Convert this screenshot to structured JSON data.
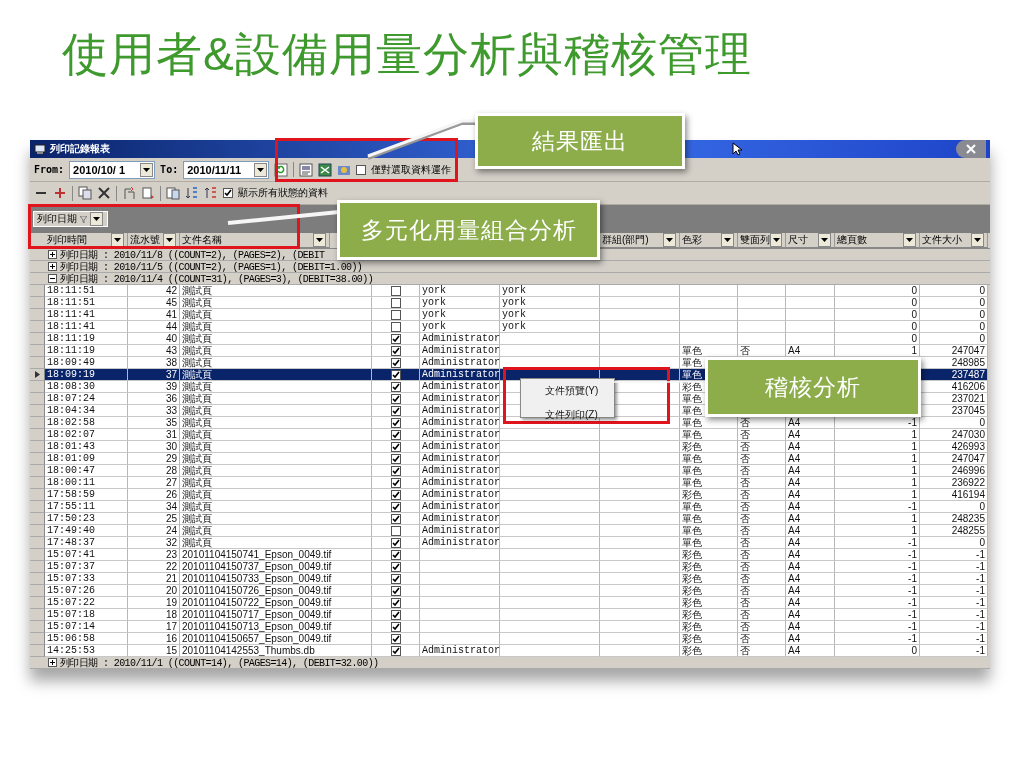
{
  "slide_title": "使用者&設備用量分析與稽核管理",
  "window": {
    "title": "列印記錄報表"
  },
  "toolbar": {
    "from_label": "From:",
    "from_date": "2010/10/ 1",
    "to_label": "To:",
    "to_date": "2010/11/11",
    "selection_only": {
      "label": "僅對選取資料運作",
      "checked": false
    }
  },
  "toolbar_2": {
    "show_all": {
      "label": "顯示所有狀態的資料",
      "checked": true
    }
  },
  "group_panel": {
    "chips": [
      "列印日期"
    ]
  },
  "columns": [
    "列印時間",
    "流水號",
    "文件名稱",
    "群組(部門)",
    "色彩",
    "雙面列",
    "尺寸",
    "總頁數",
    "文件大小"
  ],
  "groups": [
    {
      "label": "列印日期 : 2010/11/8 ((COUNT=2), (PAGES=2), (DEBIT",
      "expanded": false
    },
    {
      "label": "列印日期 : 2010/11/5 ((COUNT=2), (PAGES=1), (DEBIT=1.00))",
      "expanded": false
    },
    {
      "label": "列印日期 : 2010/11/4 ((COUNT=31), (PAGES=3), (DEBIT=38.00))",
      "expanded": true,
      "rows": [
        {
          "time": "18:11:51",
          "serial": "42",
          "file_name": "測試頁",
          "checked": false,
          "column_5": "york",
          "column_6": "york",
          "pages": "0",
          "file_size": "0",
          "selected": false
        },
        {
          "time": "18:11:51",
          "serial": "45",
          "file_name": "測試頁",
          "checked": false,
          "column_5": "york",
          "column_6": "york",
          "pages": "0",
          "file_size": "0",
          "selected": false
        },
        {
          "time": "18:11:41",
          "serial": "41",
          "file_name": "測試頁",
          "checked": false,
          "column_5": "york",
          "column_6": "york",
          "pages": "0",
          "file_size": "0",
          "selected": false
        },
        {
          "time": "18:11:41",
          "serial": "44",
          "file_name": "測試頁",
          "checked": false,
          "column_5": "york",
          "column_6": "york",
          "pages": "0",
          "file_size": "0",
          "selected": false
        },
        {
          "time": "18:11:19",
          "serial": "40",
          "file_name": "測試頁",
          "checked": true,
          "column_5": "Administrator",
          "pages": "0",
          "file_size": "0",
          "selected": false
        },
        {
          "time": "18:11:19",
          "serial": "43",
          "file_name": "測試頁",
          "checked": true,
          "column_5": "Administrator",
          "color_mode": "單色",
          "duplex": "否",
          "size": "A4",
          "pages": "1",
          "file_size": "247047",
          "selected": false
        },
        {
          "time": "18:09:49",
          "serial": "38",
          "file_name": "測試頁",
          "checked": true,
          "column_5": "Administrator",
          "color_mode": "單色",
          "file_size": "248985",
          "selected": false
        },
        {
          "time": "18:09:19",
          "serial": "37",
          "file_name": "測試頁",
          "checked": true,
          "column_5": "Administrator",
          "color_mode": "單色",
          "file_size": "237487",
          "selected": true
        },
        {
          "time": "18:08:30",
          "serial": "39",
          "file_name": "測試頁",
          "checked": true,
          "column_5": "Administrator",
          "color_mode": "彩色",
          "file_size": "416206",
          "selected": false
        },
        {
          "time": "18:07:24",
          "serial": "36",
          "file_name": "測試頁",
          "checked": true,
          "column_5": "Administrator",
          "color_mode": "單色",
          "file_size": "237021",
          "selected": false
        },
        {
          "time": "18:04:34",
          "serial": "33",
          "file_name": "測試頁",
          "checked": true,
          "column_5": "Administrator",
          "color_mode": "單色",
          "file_size": "237045",
          "selected": false
        },
        {
          "time": "18:02:58",
          "serial": "35",
          "file_name": "測試頁",
          "checked": true,
          "column_5": "Administrator",
          "color_mode": "單色",
          "duplex": "否",
          "size": "A4",
          "pages": "-1",
          "file_size": "0",
          "selected": false
        },
        {
          "time": "18:02:07",
          "serial": "31",
          "file_name": "測試頁",
          "checked": true,
          "column_5": "Administrator",
          "color_mode": "單色",
          "duplex": "否",
          "size": "A4",
          "pages": "1",
          "file_size": "247030",
          "selected": false
        },
        {
          "time": "18:01:43",
          "serial": "30",
          "file_name": "測試頁",
          "checked": true,
          "column_5": "Administrator",
          "color_mode": "彩色",
          "duplex": "否",
          "size": "A4",
          "pages": "1",
          "file_size": "426993",
          "selected": false
        },
        {
          "time": "18:01:09",
          "serial": "29",
          "file_name": "測試頁",
          "checked": true,
          "column_5": "Administrator",
          "color_mode": "單色",
          "duplex": "否",
          "size": "A4",
          "pages": "1",
          "file_size": "247047",
          "selected": false
        },
        {
          "time": "18:00:47",
          "serial": "28",
          "file_name": "測試頁",
          "checked": true,
          "column_5": "Administrator",
          "color_mode": "單色",
          "duplex": "否",
          "size": "A4",
          "pages": "1",
          "file_size": "246996",
          "selected": false
        },
        {
          "time": "18:00:11",
          "serial": "27",
          "file_name": "測試頁",
          "checked": true,
          "column_5": "Administrator",
          "color_mode": "單色",
          "duplex": "否",
          "size": "A4",
          "pages": "1",
          "file_size": "236922",
          "selected": false
        },
        {
          "time": "17:58:59",
          "serial": "26",
          "file_name": "測試頁",
          "checked": true,
          "column_5": "Administrator",
          "color_mode": "彩色",
          "duplex": "否",
          "size": "A4",
          "pages": "1",
          "file_size": "416194",
          "selected": false
        },
        {
          "time": "17:55:11",
          "serial": "34",
          "file_name": "測試頁",
          "checked": true,
          "column_5": "Administrator",
          "color_mode": "單色",
          "duplex": "否",
          "size": "A4",
          "pages": "-1",
          "file_size": "0",
          "selected": false
        },
        {
          "time": "17:50:23",
          "serial": "25",
          "file_name": "測試頁",
          "checked": true,
          "column_5": "Administrator",
          "color_mode": "單色",
          "duplex": "否",
          "size": "A4",
          "pages": "1",
          "file_size": "248235",
          "selected": false
        },
        {
          "time": "17:49:40",
          "serial": "24",
          "file_name": "測試頁",
          "checked": false,
          "column_5": "Administrator",
          "color_mode": "單色",
          "duplex": "否",
          "size": "A4",
          "pages": "1",
          "file_size": "248255",
          "selected": false
        },
        {
          "time": "17:48:37",
          "serial": "32",
          "file_name": "測試頁",
          "checked": true,
          "column_5": "Administrator",
          "color_mode": "單色",
          "duplex": "否",
          "size": "A4",
          "pages": "-1",
          "file_size": "0",
          "selected": false
        },
        {
          "time": "15:07:41",
          "serial": "23",
          "file_name": "20101104150741_Epson_0049.tif",
          "checked": true,
          "color_mode": "彩色",
          "duplex": "否",
          "size": "A4",
          "pages": "-1",
          "file_size": "-1",
          "selected": false
        },
        {
          "time": "15:07:37",
          "serial": "22",
          "file_name": "20101104150737_Epson_0049.tif",
          "checked": true,
          "color_mode": "彩色",
          "duplex": "否",
          "size": "A4",
          "pages": "-1",
          "file_size": "-1",
          "selected": false
        },
        {
          "time": "15:07:33",
          "serial": "21",
          "file_name": "20101104150733_Epson_0049.tif",
          "checked": true,
          "color_mode": "彩色",
          "duplex": "否",
          "size": "A4",
          "pages": "-1",
          "file_size": "-1",
          "selected": false
        },
        {
          "time": "15:07:26",
          "serial": "20",
          "file_name": "20101104150726_Epson_0049.tif",
          "checked": true,
          "color_mode": "彩色",
          "duplex": "否",
          "size": "A4",
          "pages": "-1",
          "file_size": "-1",
          "selected": false
        },
        {
          "time": "15:07:22",
          "serial": "19",
          "file_name": "20101104150722_Epson_0049.tif",
          "checked": true,
          "color_mode": "彩色",
          "duplex": "否",
          "size": "A4",
          "pages": "-1",
          "file_size": "-1",
          "selected": false
        },
        {
          "time": "15:07:18",
          "serial": "18",
          "file_name": "20101104150717_Epson_0049.tif",
          "checked": true,
          "color_mode": "彩色",
          "duplex": "否",
          "size": "A4",
          "pages": "-1",
          "file_size": "-1",
          "selected": false
        },
        {
          "time": "15:07:14",
          "serial": "17",
          "file_name": "20101104150713_Epson_0049.tif",
          "checked": true,
          "color_mode": "彩色",
          "duplex": "否",
          "size": "A4",
          "pages": "-1",
          "file_size": "-1",
          "selected": false
        },
        {
          "time": "15:06:58",
          "serial": "16",
          "file_name": "20101104150657_Epson_0049.tif",
          "checked": true,
          "color_mode": "彩色",
          "duplex": "否",
          "size": "A4",
          "pages": "-1",
          "file_size": "-1",
          "selected": false
        },
        {
          "time": "14:25:53",
          "serial": "15",
          "file_name": "20101104142553_Thumbs.db",
          "checked": true,
          "column_5": "Administrator",
          "color_mode": "彩色",
          "duplex": "否",
          "size": "A4",
          "pages": "0",
          "file_size": "-1",
          "selected": false
        }
      ]
    },
    {
      "label": "列印日期 : 2010/11/1 ((COUNT=14), (PAGES=14), (DEBIT=32.00))",
      "expanded": false
    }
  ],
  "context_menu": [
    "文件預覽(Y)",
    "文件列印(Z)"
  ],
  "callouts": [
    "結果匯出",
    "多元化用量組合分析",
    "稽核分析"
  ]
}
